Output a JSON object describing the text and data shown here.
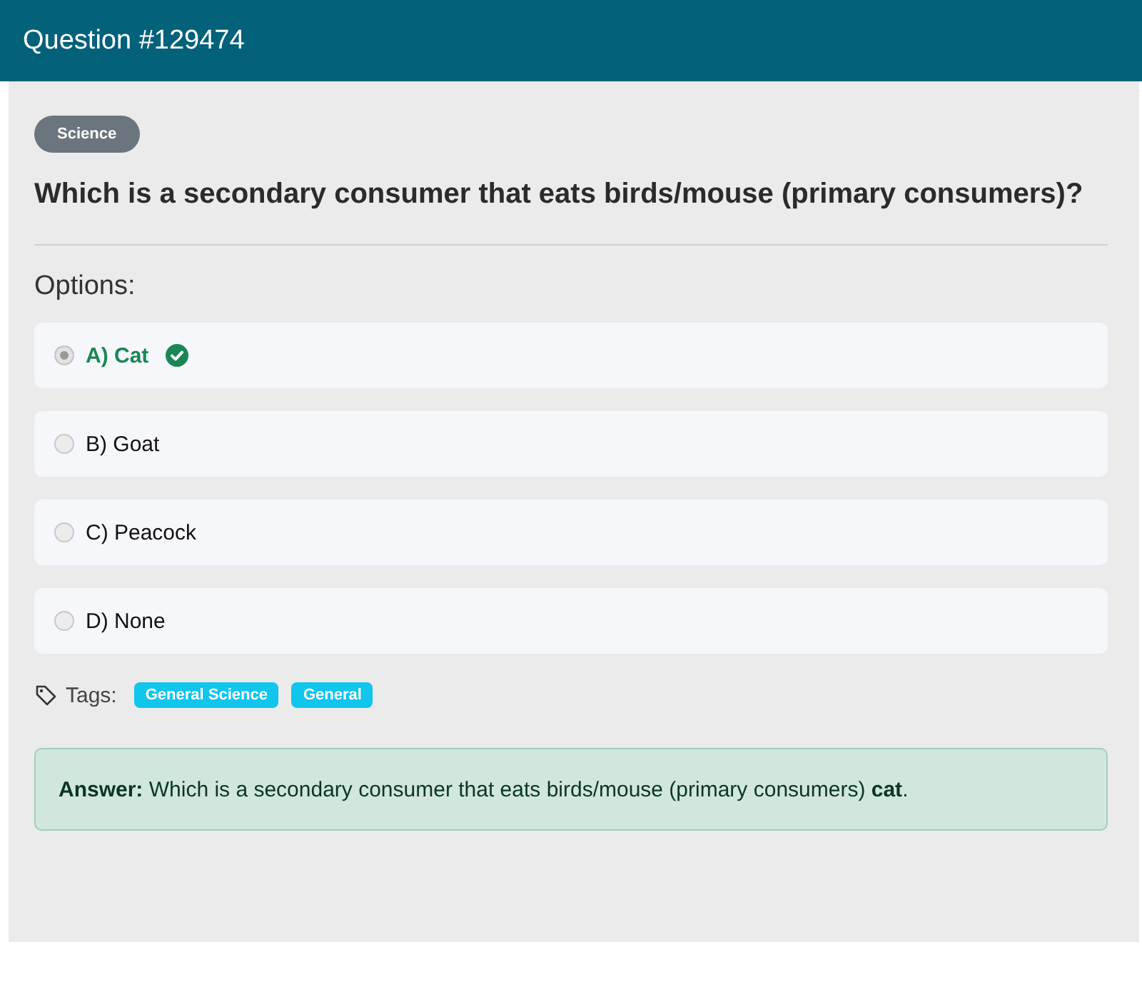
{
  "header": {
    "title": "Question #129474"
  },
  "category": "Science",
  "question": "Which is a secondary consumer that eats birds/mouse (primary consumers)?",
  "options_label": "Options:",
  "options": [
    {
      "label": "A) Cat",
      "selected": true,
      "correct": true
    },
    {
      "label": "B) Goat",
      "selected": false,
      "correct": false
    },
    {
      "label": "C) Peacock",
      "selected": false,
      "correct": false
    },
    {
      "label": "D) None",
      "selected": false,
      "correct": false
    }
  ],
  "tags_label": "Tags:",
  "tags": [
    "General Science",
    "General"
  ],
  "answer": "**Answer:** Which is a secondary consumer that eats birds/mouse (primary consumers) **cat**."
}
